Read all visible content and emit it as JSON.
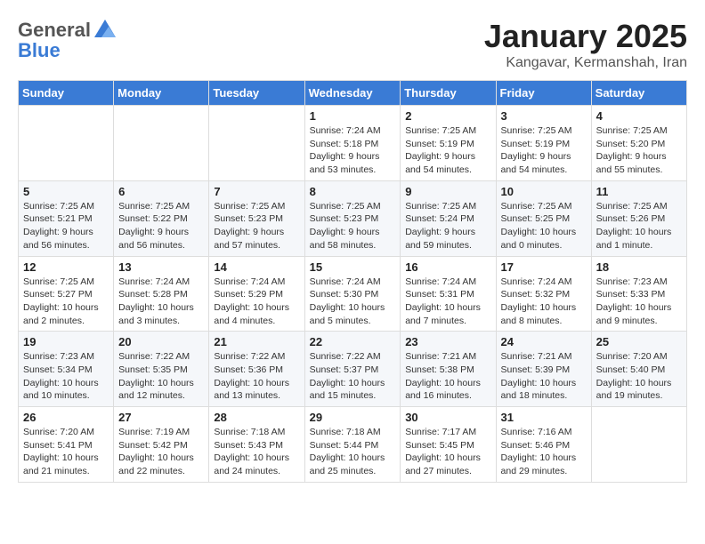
{
  "header": {
    "logo_general": "General",
    "logo_blue": "Blue",
    "month_title": "January 2025",
    "location": "Kangavar, Kermanshah, Iran"
  },
  "weekdays": [
    "Sunday",
    "Monday",
    "Tuesday",
    "Wednesday",
    "Thursday",
    "Friday",
    "Saturday"
  ],
  "weeks": [
    [
      {
        "day": "",
        "info": ""
      },
      {
        "day": "",
        "info": ""
      },
      {
        "day": "",
        "info": ""
      },
      {
        "day": "1",
        "info": "Sunrise: 7:24 AM\nSunset: 5:18 PM\nDaylight: 9 hours\nand 53 minutes."
      },
      {
        "day": "2",
        "info": "Sunrise: 7:25 AM\nSunset: 5:19 PM\nDaylight: 9 hours\nand 54 minutes."
      },
      {
        "day": "3",
        "info": "Sunrise: 7:25 AM\nSunset: 5:19 PM\nDaylight: 9 hours\nand 54 minutes."
      },
      {
        "day": "4",
        "info": "Sunrise: 7:25 AM\nSunset: 5:20 PM\nDaylight: 9 hours\nand 55 minutes."
      }
    ],
    [
      {
        "day": "5",
        "info": "Sunrise: 7:25 AM\nSunset: 5:21 PM\nDaylight: 9 hours\nand 56 minutes."
      },
      {
        "day": "6",
        "info": "Sunrise: 7:25 AM\nSunset: 5:22 PM\nDaylight: 9 hours\nand 56 minutes."
      },
      {
        "day": "7",
        "info": "Sunrise: 7:25 AM\nSunset: 5:23 PM\nDaylight: 9 hours\nand 57 minutes."
      },
      {
        "day": "8",
        "info": "Sunrise: 7:25 AM\nSunset: 5:23 PM\nDaylight: 9 hours\nand 58 minutes."
      },
      {
        "day": "9",
        "info": "Sunrise: 7:25 AM\nSunset: 5:24 PM\nDaylight: 9 hours\nand 59 minutes."
      },
      {
        "day": "10",
        "info": "Sunrise: 7:25 AM\nSunset: 5:25 PM\nDaylight: 10 hours\nand 0 minutes."
      },
      {
        "day": "11",
        "info": "Sunrise: 7:25 AM\nSunset: 5:26 PM\nDaylight: 10 hours\nand 1 minute."
      }
    ],
    [
      {
        "day": "12",
        "info": "Sunrise: 7:25 AM\nSunset: 5:27 PM\nDaylight: 10 hours\nand 2 minutes."
      },
      {
        "day": "13",
        "info": "Sunrise: 7:24 AM\nSunset: 5:28 PM\nDaylight: 10 hours\nand 3 minutes."
      },
      {
        "day": "14",
        "info": "Sunrise: 7:24 AM\nSunset: 5:29 PM\nDaylight: 10 hours\nand 4 minutes."
      },
      {
        "day": "15",
        "info": "Sunrise: 7:24 AM\nSunset: 5:30 PM\nDaylight: 10 hours\nand 5 minutes."
      },
      {
        "day": "16",
        "info": "Sunrise: 7:24 AM\nSunset: 5:31 PM\nDaylight: 10 hours\nand 7 minutes."
      },
      {
        "day": "17",
        "info": "Sunrise: 7:24 AM\nSunset: 5:32 PM\nDaylight: 10 hours\nand 8 minutes."
      },
      {
        "day": "18",
        "info": "Sunrise: 7:23 AM\nSunset: 5:33 PM\nDaylight: 10 hours\nand 9 minutes."
      }
    ],
    [
      {
        "day": "19",
        "info": "Sunrise: 7:23 AM\nSunset: 5:34 PM\nDaylight: 10 hours\nand 10 minutes."
      },
      {
        "day": "20",
        "info": "Sunrise: 7:22 AM\nSunset: 5:35 PM\nDaylight: 10 hours\nand 12 minutes."
      },
      {
        "day": "21",
        "info": "Sunrise: 7:22 AM\nSunset: 5:36 PM\nDaylight: 10 hours\nand 13 minutes."
      },
      {
        "day": "22",
        "info": "Sunrise: 7:22 AM\nSunset: 5:37 PM\nDaylight: 10 hours\nand 15 minutes."
      },
      {
        "day": "23",
        "info": "Sunrise: 7:21 AM\nSunset: 5:38 PM\nDaylight: 10 hours\nand 16 minutes."
      },
      {
        "day": "24",
        "info": "Sunrise: 7:21 AM\nSunset: 5:39 PM\nDaylight: 10 hours\nand 18 minutes."
      },
      {
        "day": "25",
        "info": "Sunrise: 7:20 AM\nSunset: 5:40 PM\nDaylight: 10 hours\nand 19 minutes."
      }
    ],
    [
      {
        "day": "26",
        "info": "Sunrise: 7:20 AM\nSunset: 5:41 PM\nDaylight: 10 hours\nand 21 minutes."
      },
      {
        "day": "27",
        "info": "Sunrise: 7:19 AM\nSunset: 5:42 PM\nDaylight: 10 hours\nand 22 minutes."
      },
      {
        "day": "28",
        "info": "Sunrise: 7:18 AM\nSunset: 5:43 PM\nDaylight: 10 hours\nand 24 minutes."
      },
      {
        "day": "29",
        "info": "Sunrise: 7:18 AM\nSunset: 5:44 PM\nDaylight: 10 hours\nand 25 minutes."
      },
      {
        "day": "30",
        "info": "Sunrise: 7:17 AM\nSunset: 5:45 PM\nDaylight: 10 hours\nand 27 minutes."
      },
      {
        "day": "31",
        "info": "Sunrise: 7:16 AM\nSunset: 5:46 PM\nDaylight: 10 hours\nand 29 minutes."
      },
      {
        "day": "",
        "info": ""
      }
    ]
  ]
}
